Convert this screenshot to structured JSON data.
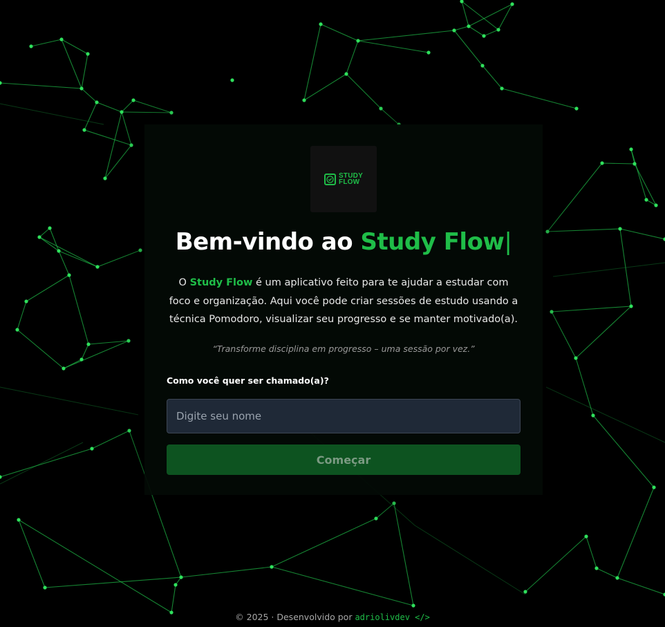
{
  "colors": {
    "accent": "#1fbd48",
    "background": "#000000",
    "input_bg": "#1f2937",
    "button_bg": "#0d5320"
  },
  "logo": {
    "icon": "clock-check-icon",
    "line1": "STUDY",
    "line2": "FLOW"
  },
  "title": {
    "prefix": "Bem-vindo ao ",
    "accent": "Study Flow",
    "cursor": "|"
  },
  "description": {
    "part1": "O ",
    "brand": "Study Flow",
    "part2": " é um aplicativo feito para te ajudar a estudar com foco e organização. Aqui você pode criar sessões de estudo usando a técnica Pomodoro, visualizar seu progresso e se manter motivado(a)."
  },
  "quote": "“Transforme disciplina em progresso – uma sessão por vez.”",
  "form": {
    "label": "Como você quer ser chamado(a)?",
    "placeholder": "Digite seu nome",
    "value": "",
    "button_label": "Começar"
  },
  "footer": {
    "text": "© 2025 · Desenvolvido por ",
    "link_text": "adriolivdev </>"
  }
}
